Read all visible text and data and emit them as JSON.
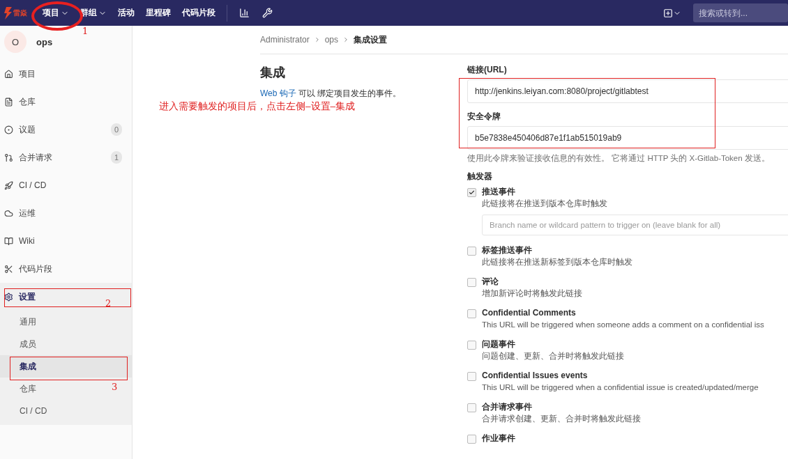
{
  "topbar": {
    "logo_text": "雷焱",
    "nav": [
      {
        "label": "项目",
        "dropdown": true
      },
      {
        "label": "群组",
        "dropdown": true
      },
      {
        "label": "活动",
        "dropdown": false
      },
      {
        "label": "里程碑",
        "dropdown": false
      },
      {
        "label": "代码片段",
        "dropdown": false
      }
    ],
    "search": {
      "placeholder": "搜索或转到..."
    }
  },
  "sidebar": {
    "project": {
      "avatar": "O",
      "name": "ops"
    },
    "items": [
      {
        "label": "项目",
        "selected": false
      },
      {
        "label": "仓库",
        "selected": false
      },
      {
        "label": "议题",
        "count": "0",
        "selected": false
      },
      {
        "label": "合并请求",
        "count": "1",
        "selected": false
      },
      {
        "label": "CI / CD",
        "selected": false
      },
      {
        "label": "运维",
        "selected": false
      },
      {
        "label": "Wiki",
        "selected": false
      },
      {
        "label": "代码片段",
        "selected": false
      },
      {
        "label": "设置",
        "selected": true,
        "expanded": true,
        "children": [
          {
            "label": "通用",
            "selected": false
          },
          {
            "label": "成员",
            "selected": false
          },
          {
            "label": "集成",
            "selected": true
          },
          {
            "label": "仓库",
            "selected": false
          },
          {
            "label": "CI / CD",
            "selected": false
          }
        ]
      }
    ]
  },
  "breadcrumb": [
    "Administrator",
    "ops",
    "集成设置"
  ],
  "intro": {
    "title": "集成",
    "link": "Web 钩子",
    "text": "可以 绑定项目发生的事件。"
  },
  "form": {
    "url": {
      "label": "链接(URL)",
      "value": "http://jenkins.leiyan.com:8080/project/gitlabtest"
    },
    "token": {
      "label": "安全令牌",
      "value": "b5e7838e450406d87e1f1ab515019ab9",
      "hint": "使用此令牌来验证接收信息的有效性。 它将通过 HTTP 头的 X-Gitlab-Token 发送。"
    },
    "triggers_label": "触发器",
    "triggers": [
      {
        "label": "推送事件",
        "description": "此链接将在推送到版本仓库时触发",
        "checked": true,
        "placeholder": "Branch name or wildcard pattern to trigger on (leave blank for all)"
      },
      {
        "label": "标签推送事件",
        "description": "此链接将在推送新标签到版本仓库时触发",
        "checked": false
      },
      {
        "label": "评论",
        "description": "增加新评论时将触发此链接",
        "checked": false
      },
      {
        "label": "Confidential Comments",
        "description": "This URL will be triggered when someone adds a comment on a confidential iss",
        "checked": false
      },
      {
        "label": "问题事件",
        "description": "问题创建、更新、合并时将触发此链接",
        "checked": false
      },
      {
        "label": "Confidential Issues events",
        "description": "This URL will be triggered when a confidential issue is created/updated/merge",
        "checked": false
      },
      {
        "label": "合并请求事件",
        "description": "合并请求创建、更新、合并时将触发此链接",
        "checked": false
      },
      {
        "label": "作业事件",
        "checked": false
      }
    ]
  },
  "annotations": {
    "note": "进入需要触发的项目后，点击左侧–设置–集成",
    "markers": [
      "1",
      "2",
      "3"
    ]
  }
}
